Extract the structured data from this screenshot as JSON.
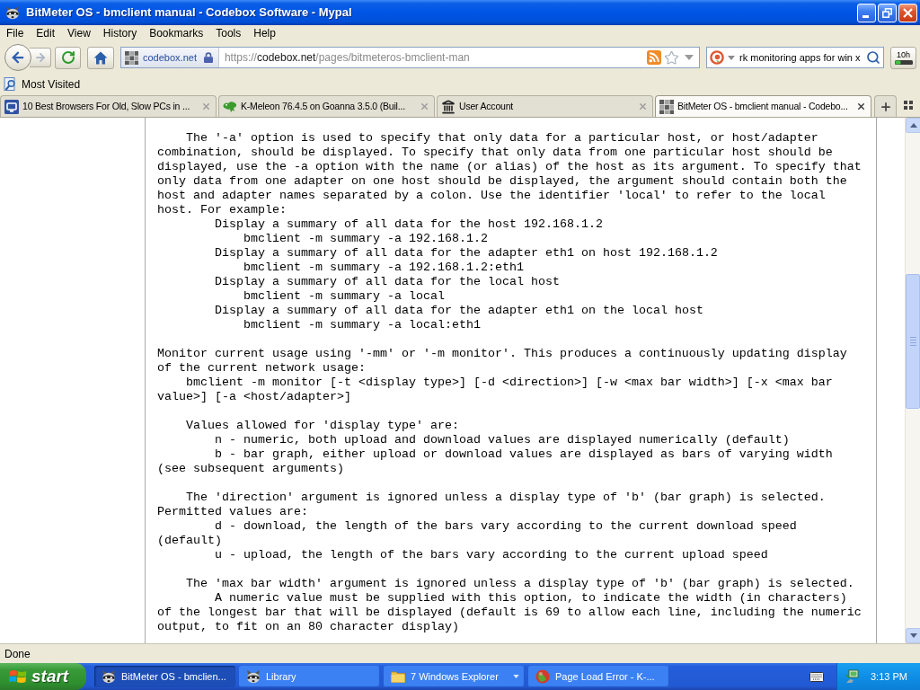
{
  "window": {
    "title": "BitMeter OS - bmclient manual - Codebox Software - Mypal"
  },
  "menu_bar": [
    "File",
    "Edit",
    "View",
    "History",
    "Bookmarks",
    "Tools",
    "Help"
  ],
  "navigation": {
    "forward_disabled": true,
    "identity": "codebox.net",
    "url": {
      "scheme": "https://",
      "host": "codebox.net",
      "path": "/pages/bitmeteros-bmclient-man"
    },
    "search": {
      "value": "rk monitoring apps for win x"
    },
    "addon_button": "10h"
  },
  "bookmarks_bar": [
    "Most Visited"
  ],
  "tabs": [
    {
      "title": "10 Best Browsers For Old, Slow PCs in ...",
      "selected": false
    },
    {
      "title": "K-Meleon 76.4.5 on Goanna 3.5.0 (Buil...",
      "selected": false
    },
    {
      "title": "User Account",
      "selected": false
    },
    {
      "title": "BitMeter OS - bmclient manual - Codebo...",
      "selected": true
    }
  ],
  "document": {
    "blocks": [
      {
        "paragraphs": [
          {
            "kind": "indent",
            "lines": [
              "The '-a' option is used to specify that only data for a particular host, or host/adapter",
              "combination, should be displayed. To specify that only data from one particular host should be",
              "displayed, use the -a option with the name (or alias) of the host as its argument. To specify that",
              "only data from one adapter on one host should be displayed, the argument should contain both the",
              "host and adapter names separated by a colon. Use the identifier 'local' to refer to the local",
              "host. For example:"
            ]
          },
          {
            "kind": "item",
            "lines": [
              "Display a summary of all data for the host 192.168.1.2"
            ]
          },
          {
            "kind": "command",
            "lines": [
              "bmclient -m summary -a 192.168.1.2"
            ]
          },
          {
            "kind": "item",
            "lines": [
              "Display a summary of all data for the adapter eth1 on host 192.168.1.2"
            ]
          },
          {
            "kind": "command",
            "lines": [
              "bmclient -m summary -a 192.168.1.2:eth1"
            ]
          },
          {
            "kind": "item",
            "lines": [
              "Display a summary of all data for the local host"
            ]
          },
          {
            "kind": "command",
            "lines": [
              "bmclient -m summary -a local"
            ]
          },
          {
            "kind": "item",
            "lines": [
              "Display a summary of all data for the adapter eth1 on the local host"
            ]
          },
          {
            "kind": "command",
            "lines": [
              "bmclient -m summary -a local:eth1"
            ]
          }
        ]
      },
      {
        "paragraphs": [
          {
            "kind": "text",
            "lines": [
              "Monitor current usage using '-mm' or '-m monitor'. This produces a continuously updating display",
              "of the current network usage:"
            ]
          },
          {
            "kind": "indent",
            "lines": [
              "bmclient -m monitor [-t <display type>] [-d <direction>] [-w <max bar width>] [-x <max bar",
              "value>] [-a <host/adapter>]"
            ]
          }
        ]
      },
      {
        "paragraphs": [
          {
            "kind": "indent",
            "lines": [
              "Values allowed for 'display type' are:"
            ]
          },
          {
            "kind": "item",
            "lines": [
              "n - numeric, both upload and download values are displayed numerically (default)"
            ]
          },
          {
            "kind": "item",
            "lines": [
              "b - bar graph, either upload or download values are displayed as bars of varying width",
              "(see subsequent arguments)"
            ]
          }
        ]
      },
      {
        "paragraphs": [
          {
            "kind": "indent",
            "lines": [
              "The 'direction' argument is ignored unless a display type of 'b' (bar graph) is selected.",
              "Permitted values are:"
            ]
          },
          {
            "kind": "item",
            "lines": [
              "d - download, the length of the bars vary according to the current download speed",
              "(default)"
            ]
          },
          {
            "kind": "item",
            "lines": [
              "u - upload, the length of the bars vary according to the current upload speed"
            ]
          }
        ]
      },
      {
        "paragraphs": [
          {
            "kind": "indent",
            "lines": [
              "The 'max bar width' argument is ignored unless a display type of 'b' (bar graph) is selected."
            ]
          },
          {
            "kind": "item",
            "lines": [
              "A numeric value must be supplied with this option, to indicate the width (in characters)",
              "of the longest bar that will be displayed (default is 69 to allow each line, including the numeric",
              "output, to fit on an 80 character display)"
            ]
          }
        ]
      }
    ]
  },
  "status_bar": "Done",
  "taskbar": {
    "start": "start",
    "tasks": [
      {
        "label": "BitMeter OS - bmclien...",
        "kind": "window",
        "selected": true
      },
      {
        "label": "Library",
        "kind": "window",
        "selected": false
      },
      {
        "label": "7 Windows Explorer",
        "kind": "group",
        "selected": false
      },
      {
        "label": "Page Load Error - K-...",
        "kind": "window",
        "selected": false
      }
    ],
    "clock": "3:13 PM"
  }
}
